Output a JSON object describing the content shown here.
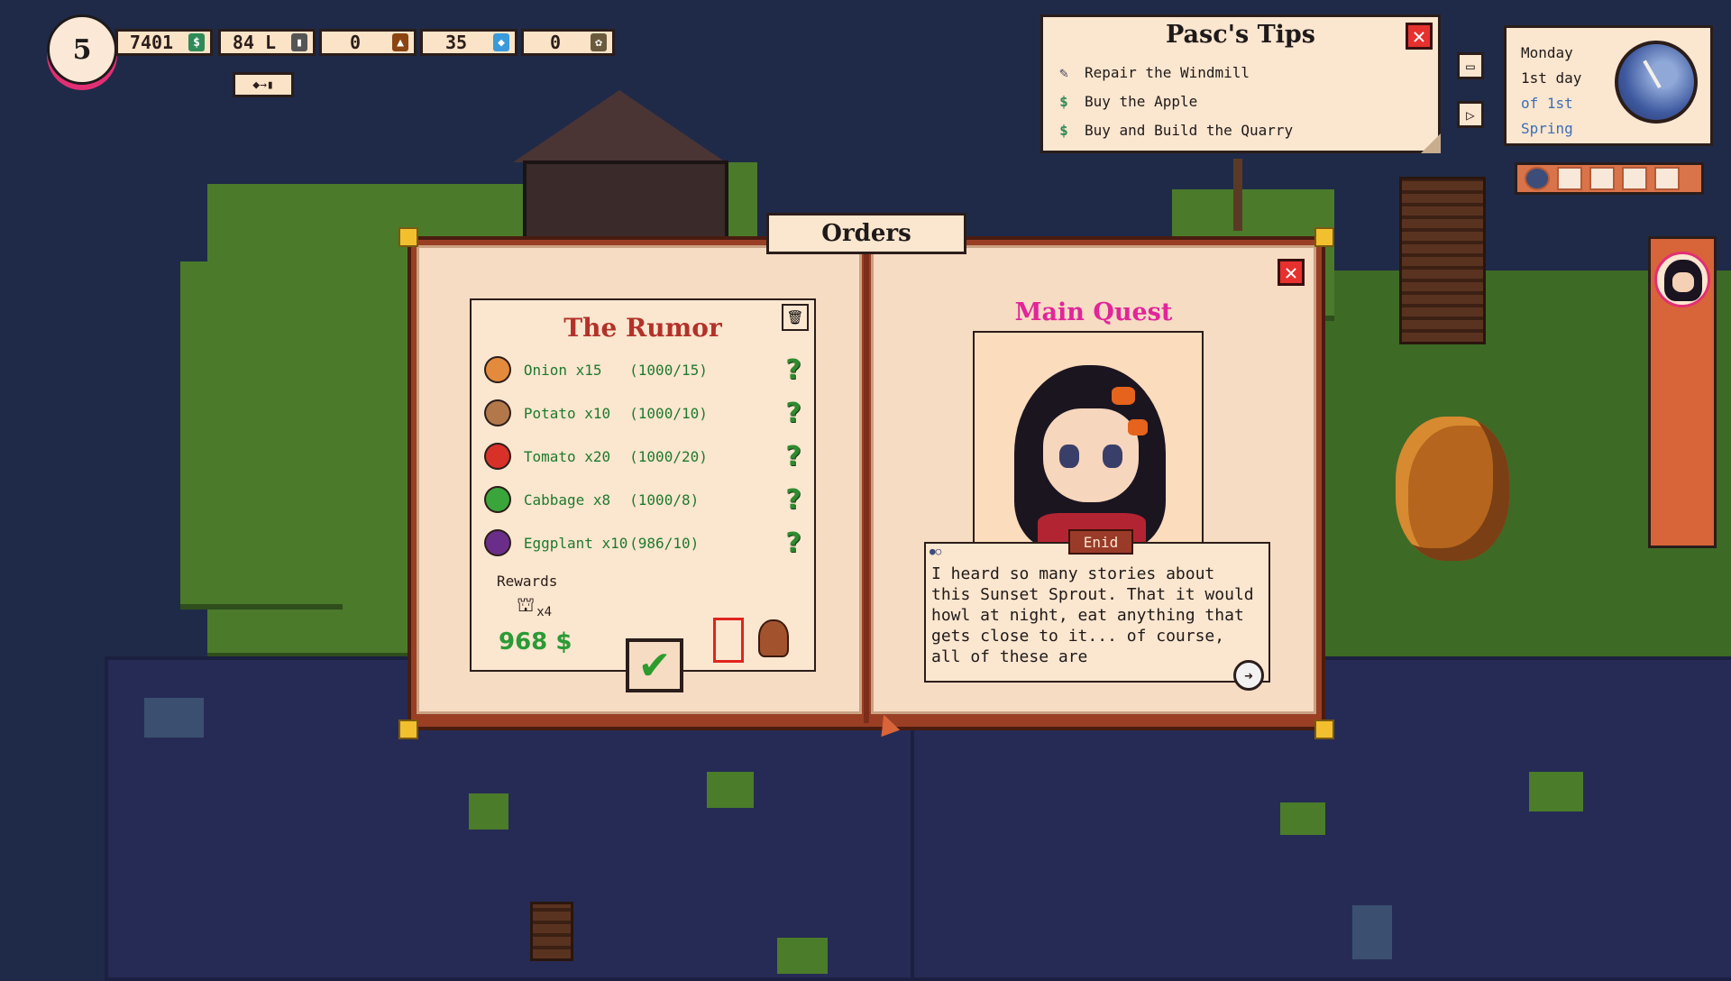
{
  "hud": {
    "level": "5",
    "resources": [
      {
        "id": "money",
        "value": "7401",
        "icon": "money-icon",
        "color": "#2e8b57",
        "glyph": "$"
      },
      {
        "id": "fuel",
        "value": "84 L",
        "icon": "fuel-canister-icon",
        "color": "#555555",
        "glyph": "▮"
      },
      {
        "id": "wood",
        "value": "0",
        "icon": "wood-icon",
        "color": "#8b4513",
        "glyph": "▲"
      },
      {
        "id": "gems",
        "value": "35",
        "icon": "gem-icon",
        "color": "#3b9ad9",
        "glyph": "◆"
      },
      {
        "id": "seeds",
        "value": "0",
        "icon": "seed-icon",
        "color": "#6b5b3e",
        "glyph": "✿"
      }
    ],
    "convert_icon": "gem-to-fuel-convert-icon"
  },
  "tips": {
    "title": "Pasc's Tips",
    "items": [
      {
        "label": "Repair the Windmill",
        "icon": "wrench-icon",
        "glyph": "✎",
        "color": "#3a3f5a"
      },
      {
        "label": "Buy the Apple",
        "icon": "money-icon",
        "glyph": "$",
        "color": "#2e8b57"
      },
      {
        "label": "Buy and Build the Quarry",
        "icon": "money-icon",
        "glyph": "$",
        "color": "#2e8b57"
      }
    ]
  },
  "calendar": {
    "weekday": "Monday",
    "day": "1st day",
    "of": "of 1st",
    "season": "Spring"
  },
  "orders": {
    "tab_title": "Orders",
    "order": {
      "title": "The Rumor",
      "items": [
        {
          "name": "Onion x15",
          "progress": "(1000/15)",
          "icon": "onion-icon",
          "color": "#e48a3c"
        },
        {
          "name": "Potato x10",
          "progress": "(1000/10)",
          "icon": "potato-icon",
          "color": "#b2784a"
        },
        {
          "name": "Tomato x20",
          "progress": "(1000/20)",
          "icon": "tomato-icon",
          "color": "#d8312a"
        },
        {
          "name": "Cabbage x8",
          "progress": "(1000/8)",
          "icon": "cabbage-icon",
          "color": "#3aa53a"
        },
        {
          "name": "Eggplant x10",
          "progress": "(986/10)",
          "icon": "eggplant-icon",
          "color": "#6a2e8a"
        }
      ],
      "help": "?",
      "rewards_label": "Rewards",
      "reward_item": {
        "count": "x4",
        "icon": "seed-bag-icon"
      },
      "money": "968 $"
    },
    "quest": {
      "title": "Main Quest",
      "speaker": "Enid",
      "dialog": "I heard so many stories about this Sunset Sprout. That it would howl at night, eat anything that gets close to it... of course, all of these are"
    }
  }
}
